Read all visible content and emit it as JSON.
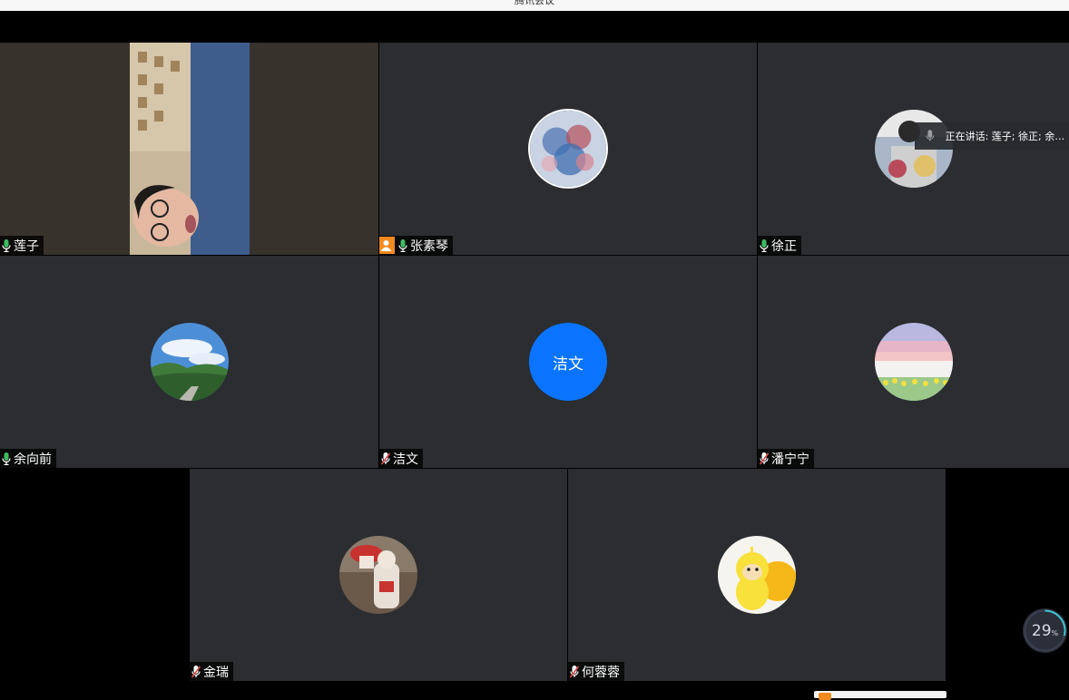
{
  "window": {
    "title": "腾讯会议"
  },
  "participants": [
    {
      "name": "莲子",
      "mic": "on",
      "video": true
    },
    {
      "name": "张素琴",
      "mic": "on",
      "host": true,
      "avatar": "painting"
    },
    {
      "name": "徐正",
      "mic": "on",
      "avatar": "photo-person"
    },
    {
      "name": "余向前",
      "mic": "on",
      "avatar": "landscape"
    },
    {
      "name": "洁文",
      "mic": "muted",
      "avatar_text": "洁文"
    },
    {
      "name": "潘宁宁",
      "mic": "muted",
      "avatar": "sunset-tulips"
    },
    {
      "name": "金瑞",
      "mic": "muted",
      "avatar": "cartoon"
    },
    {
      "name": "何蓉蓉",
      "mic": "muted",
      "avatar": "yellow-doll"
    }
  ],
  "speaking_indicator": {
    "text": "正在讲话: 莲子; 徐正; 余向..."
  },
  "network": {
    "value": "29",
    "unit": "%"
  },
  "colors": {
    "tile_bg": "#2b2d31",
    "active_border": "#2fae5a",
    "mic_on": "#3dbb61",
    "mic_muted": "#e5484d",
    "host": "#f28a20",
    "initials_bg": "#0a74ff"
  }
}
